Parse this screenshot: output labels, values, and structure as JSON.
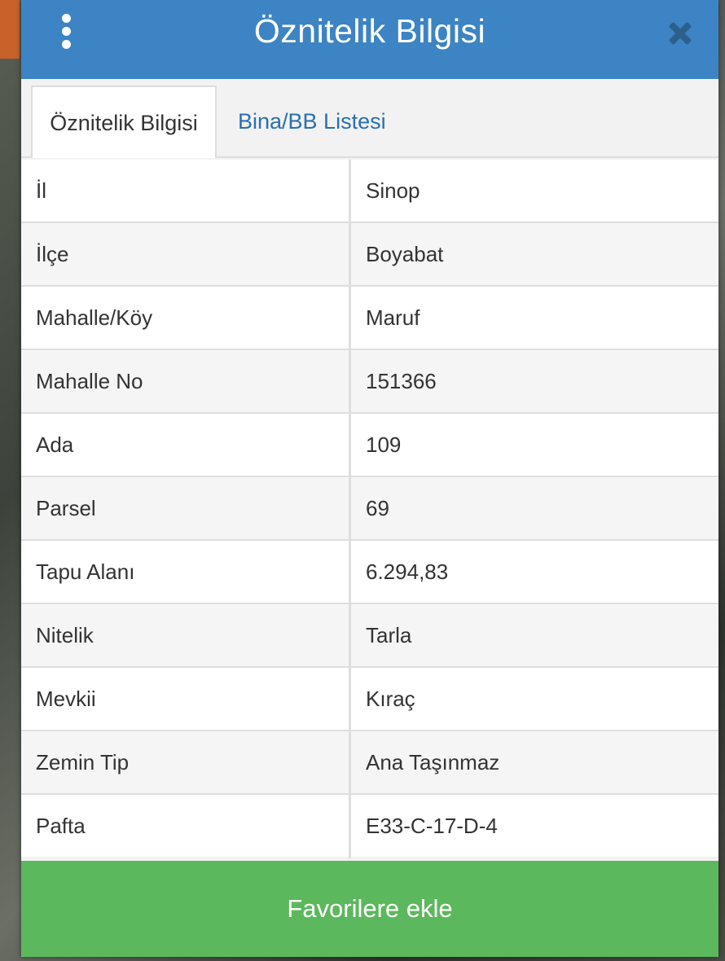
{
  "dialog": {
    "title": "Öznitelik Bilgisi",
    "menu_icon": "vertical-ellipsis-icon",
    "close_icon": "close-icon"
  },
  "tabs": [
    {
      "label": "Öznitelik Bilgisi",
      "active": true
    },
    {
      "label": "Bina/BB Listesi",
      "active": false
    }
  ],
  "attributes": [
    {
      "key": "İl",
      "value": "Sinop"
    },
    {
      "key": "İlçe",
      "value": "Boyabat"
    },
    {
      "key": "Mahalle/Köy",
      "value": "Maruf"
    },
    {
      "key": "Mahalle No",
      "value": "151366"
    },
    {
      "key": "Ada",
      "value": "109"
    },
    {
      "key": "Parsel",
      "value": "69"
    },
    {
      "key": "Tapu Alanı",
      "value": "6.294,83"
    },
    {
      "key": "Nitelik",
      "value": "Tarla"
    },
    {
      "key": "Mevkii",
      "value": "Kıraç"
    },
    {
      "key": "Zemin Tip",
      "value": "Ana Taşınmaz"
    },
    {
      "key": "Pafta",
      "value": "E33-C-17-D-4"
    }
  ],
  "favorite_button": {
    "label": "Favorilere ekle"
  },
  "colors": {
    "header": "#3c84c4",
    "tab_link": "#2a6fb0",
    "favorite": "#5cb85c"
  }
}
